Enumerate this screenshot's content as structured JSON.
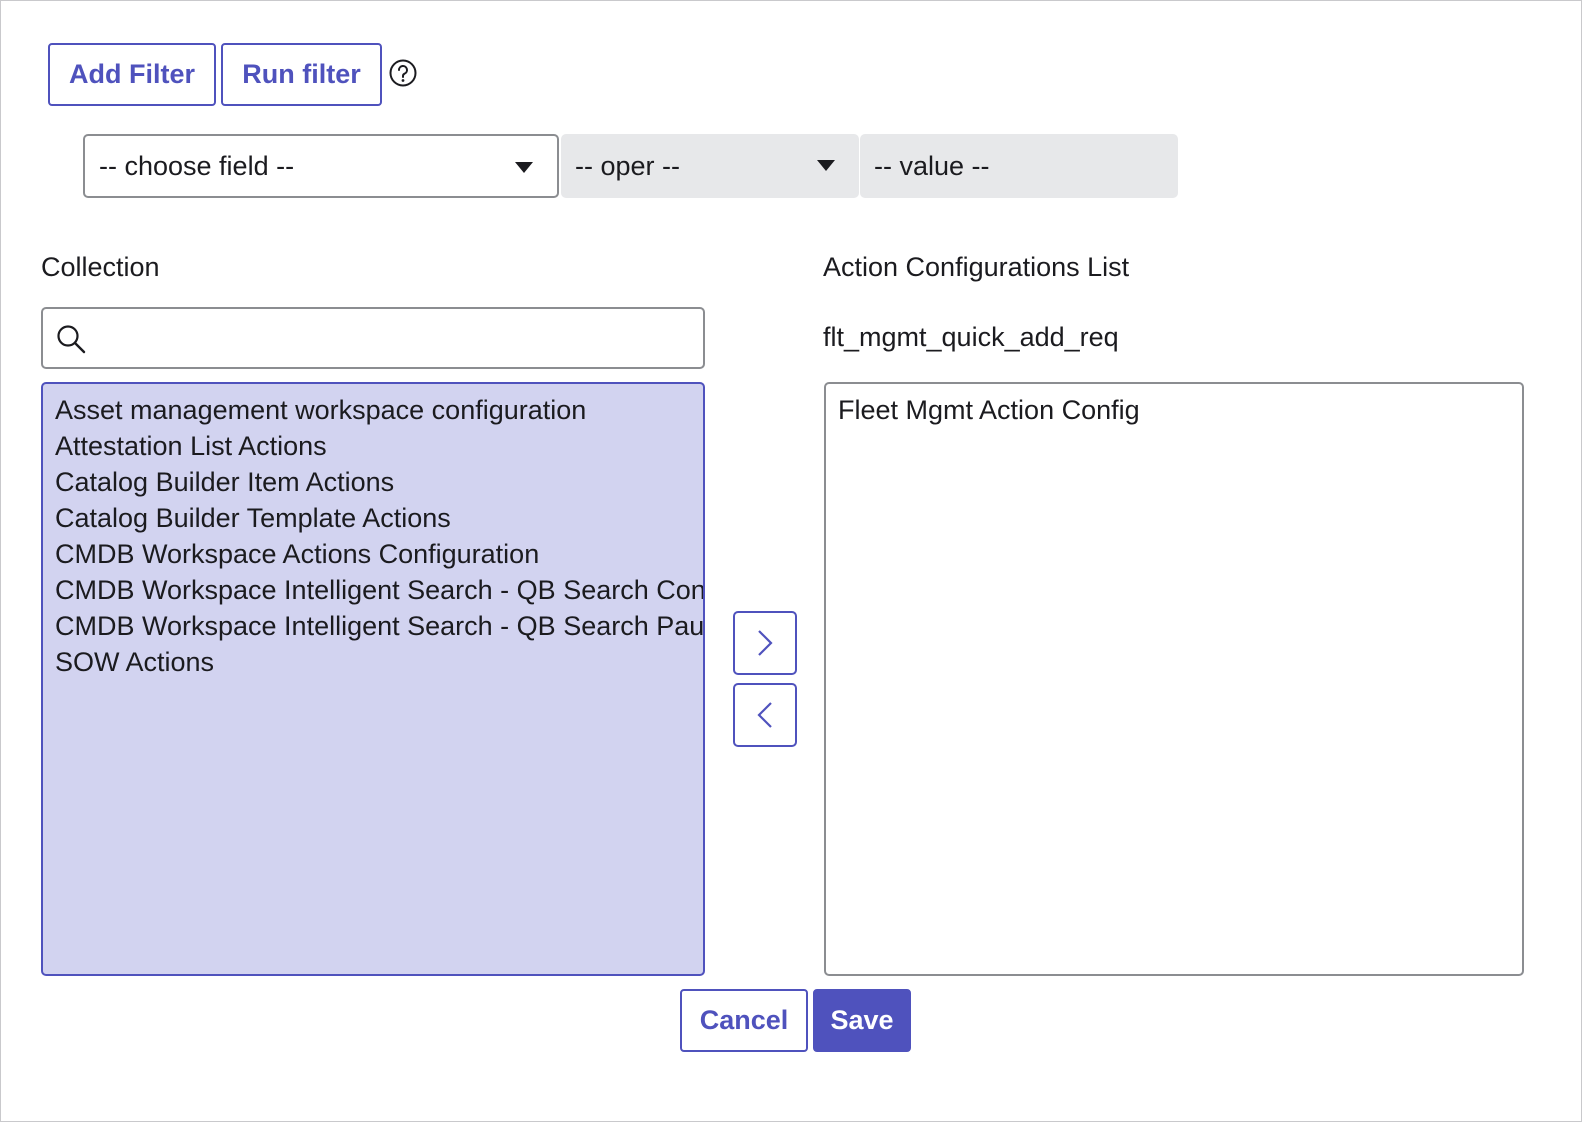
{
  "toolbar": {
    "add_filter_label": "Add Filter",
    "run_filter_label": "Run filter"
  },
  "filter": {
    "field_placeholder": "-- choose field --",
    "oper_placeholder": "-- oper --",
    "value_placeholder": "-- value --"
  },
  "collection": {
    "heading": "Collection",
    "search_value": "",
    "items": [
      "Asset management workspace configuration",
      "Attestation List Actions",
      "Catalog Builder Item Actions",
      "Catalog Builder Template Actions",
      "CMDB Workspace Actions Configuration",
      "CMDB Workspace Intelligent Search - QB Search Con",
      "CMDB Workspace Intelligent Search - QB Search Pau",
      "SOW Actions"
    ]
  },
  "selected": {
    "heading": "Action Configurations List",
    "subheading": "flt_mgmt_quick_add_req",
    "items": [
      "Fleet Mgmt Action Config"
    ]
  },
  "footer": {
    "cancel_label": "Cancel",
    "save_label": "Save"
  },
  "icons": {
    "help": "help-circle-icon",
    "search": "search-icon",
    "move_right": "chevron-right-icon",
    "move_left": "chevron-left-icon",
    "dropdown": "caret-down-icon"
  },
  "colors": {
    "accent": "#4f52bd",
    "selection": "#d2d3f0",
    "disabled_bg": "#e7e8ea",
    "border": "#8b8d91"
  }
}
